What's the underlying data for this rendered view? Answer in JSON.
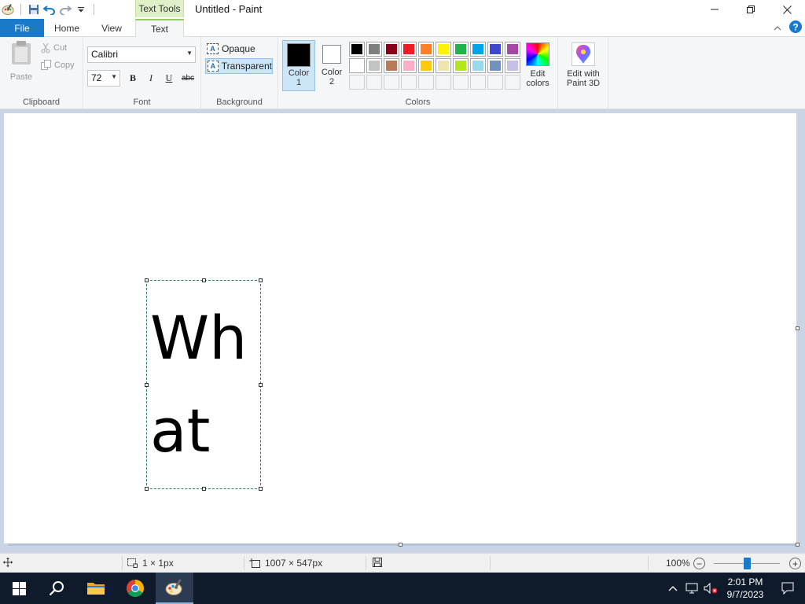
{
  "titlebar": {
    "context_tab_group": "Text Tools",
    "window_title": "Untitled - Paint"
  },
  "tabs": {
    "file": "File",
    "home": "Home",
    "view": "View",
    "text": "Text"
  },
  "clipboard": {
    "paste": "Paste",
    "cut": "Cut",
    "copy": "Copy",
    "group_label": "Clipboard"
  },
  "font": {
    "family": "Calibri",
    "size": "72",
    "bold": "B",
    "italic": "I",
    "underline": "U",
    "strikethrough": "abc",
    "group_label": "Font"
  },
  "background": {
    "opaque": "Opaque",
    "transparent": "Transparent",
    "selected": "Transparent",
    "group_label": "Background"
  },
  "colors": {
    "color1_label_a": "Color",
    "color1_label_b": "1",
    "color2_label_a": "Color",
    "color2_label_b": "2",
    "color1_value": "#000000",
    "color2_value": "#ffffff",
    "edit_colors_a": "Edit",
    "edit_colors_b": "colors",
    "group_label": "Colors",
    "palette_row1": [
      "#000000",
      "#7f7f7f",
      "#880015",
      "#ed1c24",
      "#ff7f27",
      "#fff200",
      "#22b14c",
      "#00a2e8",
      "#3f48cc",
      "#a349a4"
    ],
    "palette_row2": [
      "#ffffff",
      "#c3c3c3",
      "#b97a57",
      "#ffaec9",
      "#ffc90e",
      "#efe4b0",
      "#b5e61d",
      "#99d9ea",
      "#7092be",
      "#c8bfe7"
    ]
  },
  "paint3d": {
    "label_a": "Edit with",
    "label_b": "Paint 3D"
  },
  "canvas": {
    "text_content": "What"
  },
  "statusbar": {
    "selection_size": "1 × 1px",
    "canvas_size": "1007 × 547px",
    "zoom": "100%",
    "zoom_level": 0.5
  },
  "taskbar": {
    "time": "2:01 PM",
    "date": "9/7/2023"
  }
}
